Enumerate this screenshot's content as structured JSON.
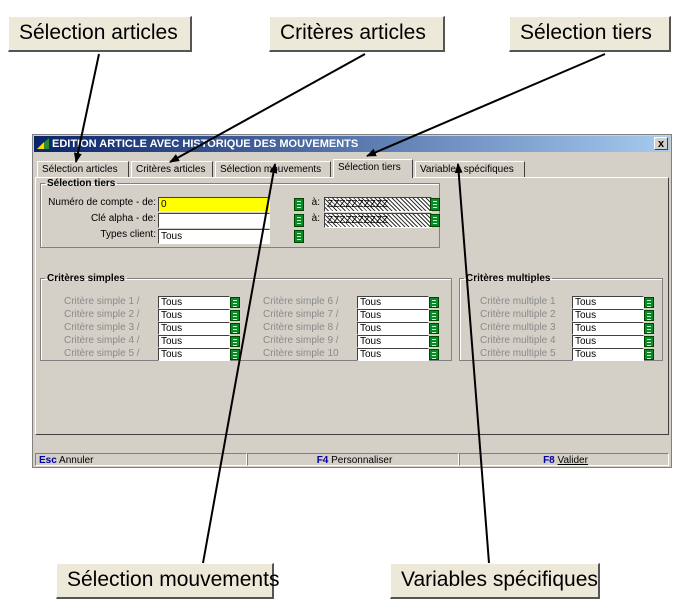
{
  "callouts": {
    "selection_articles": "Sélection articles",
    "criteres_articles": "Critères articles",
    "selection_tiers": "Sélection tiers",
    "selection_mouvements": "Sélection mouvements",
    "variables_specifiques": "Variables spécifiques"
  },
  "window": {
    "title": "EDITION ARTICLE AVEC HISTORIQUE DES MOUVEMENTS",
    "close": "x"
  },
  "tabs": [
    "Sélection articles",
    "Critères articles",
    "Sélection mouvements",
    "Sélection tiers",
    "Variables spécifiques"
  ],
  "active_tab": "Sélection tiers",
  "selection_tiers": {
    "legend": "Sélection tiers",
    "account_label": "Numéro de compte - de:",
    "account_from": "0",
    "account_to_label": "à:",
    "account_to": "ZZZZZZZZZZ",
    "alpha_label": "Clé alpha - de:",
    "alpha_from": "",
    "alpha_to_label": "à:",
    "alpha_to": "ZZZZZZZZZZ",
    "types_label": "Types client:",
    "types_value": "Tous"
  },
  "criteres_simples": {
    "legend": "Critères simples",
    "items": [
      {
        "label": "Critère simple 1 /",
        "value": "Tous"
      },
      {
        "label": "Critère simple 2 /",
        "value": "Tous"
      },
      {
        "label": "Critère simple 3 /",
        "value": "Tous"
      },
      {
        "label": "Critère simple 4 /",
        "value": "Tous"
      },
      {
        "label": "Critère simple 5 /",
        "value": "Tous"
      },
      {
        "label": "Critère simple 6 /",
        "value": "Tous"
      },
      {
        "label": "Critère simple 7 /",
        "value": "Tous"
      },
      {
        "label": "Critère simple 8 /",
        "value": "Tous"
      },
      {
        "label": "Critère simple 9 /",
        "value": "Tous"
      },
      {
        "label": "Critère simple 10",
        "value": "Tous"
      }
    ]
  },
  "criteres_multiples": {
    "legend": "Critères multiples",
    "items": [
      {
        "label": "Critère multiple 1",
        "value": "Tous"
      },
      {
        "label": "Critère multiple 2",
        "value": "Tous"
      },
      {
        "label": "Critère multiple 3",
        "value": "Tous"
      },
      {
        "label": "Critère multiple 4",
        "value": "Tous"
      },
      {
        "label": "Critère multiple 5",
        "value": "Tous"
      }
    ]
  },
  "statusbar": {
    "esc_key": "Esc",
    "esc_label": "Annuler",
    "f4_key": "F4",
    "f4_label": "Personnaliser",
    "f8_key": "F8",
    "f8_label": "Valider"
  },
  "colors": {
    "title_start": "#0a246a",
    "title_end": "#a6caf0",
    "highlight": "#ffff00",
    "lookup": "#0a8a2a"
  },
  "icons": [
    "app-icon",
    "lookup-icon",
    "close-icon",
    "arrow-icon"
  ]
}
